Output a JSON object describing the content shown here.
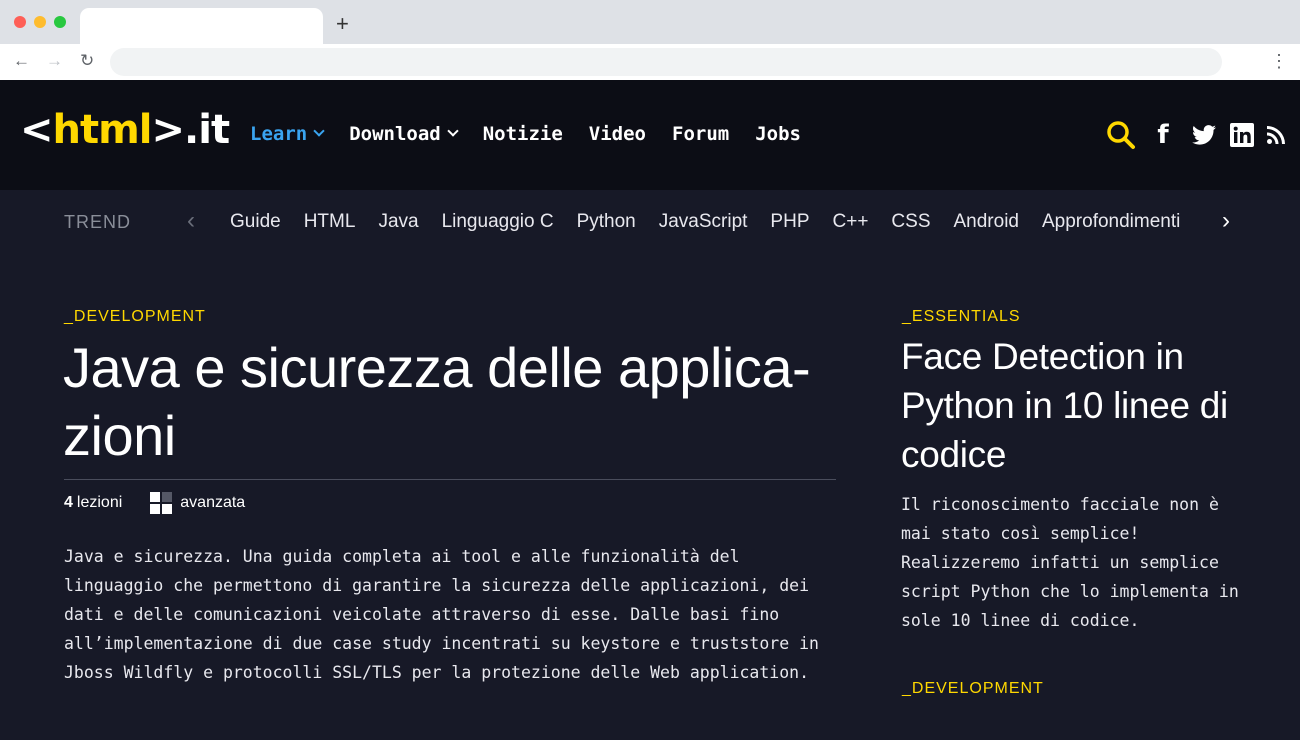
{
  "browser": {
    "new_tab_label": "+",
    "back_icon": "←",
    "forward_icon": "→",
    "reload_icon": "↻",
    "menu_icon": "⋮"
  },
  "header": {
    "logo": {
      "open": "<",
      "word": "html",
      "close": ">",
      "tld": ".it"
    },
    "nav": [
      {
        "label": "Learn",
        "dropdown": true,
        "active": true
      },
      {
        "label": "Download",
        "dropdown": true
      },
      {
        "label": "Notizie"
      },
      {
        "label": "Video"
      },
      {
        "label": "Forum"
      },
      {
        "label": "Jobs"
      }
    ],
    "icons": [
      "search-icon",
      "facebook-icon",
      "twitter-icon",
      "linkedin-icon",
      "rss-icon"
    ],
    "facebook_glyph": "f"
  },
  "trend": {
    "label": "TREND",
    "prev": "‹",
    "next": "›",
    "items": [
      "Guide",
      "HTML",
      "Java",
      "Linguaggio C",
      "Python",
      "JavaScript",
      "PHP",
      "C++",
      "CSS",
      "Android",
      "Approfondimenti"
    ]
  },
  "article": {
    "category": "_DEVELOPMENT",
    "title": "Java e sicurezza delle applica-zioni",
    "lessons_count": "4",
    "lessons_label": "lezioni",
    "level": "avanzata",
    "description": "Java e sicurezza. Una guida completa ai tool e alle funzionalità del linguaggio che permettono di garantire la sicurezza delle applicazioni, dei dati e delle comunicazioni veicolate attraverso di esse. Dalle basi fino all’implementazione di due case study incentrati su keystore e truststore in Jboss Wildfly e protocolli SSL/TLS per la protezione delle Web application."
  },
  "sidebar": {
    "category": "_ESSENTIALS",
    "title": "Face Detection in Python in 10 linee di codice",
    "description": "Il riconoscimento facciale non è mai stato così semplice! Realizzeremo infatti un semplice script Python che lo implementa in sole 10 linee di codice.",
    "next_category": "_DEVELOPMENT"
  },
  "colors": {
    "accent_yellow": "#ffd800",
    "accent_blue": "#3aa4f0",
    "header_bg": "#0c0d15",
    "content_bg": "#171927"
  }
}
